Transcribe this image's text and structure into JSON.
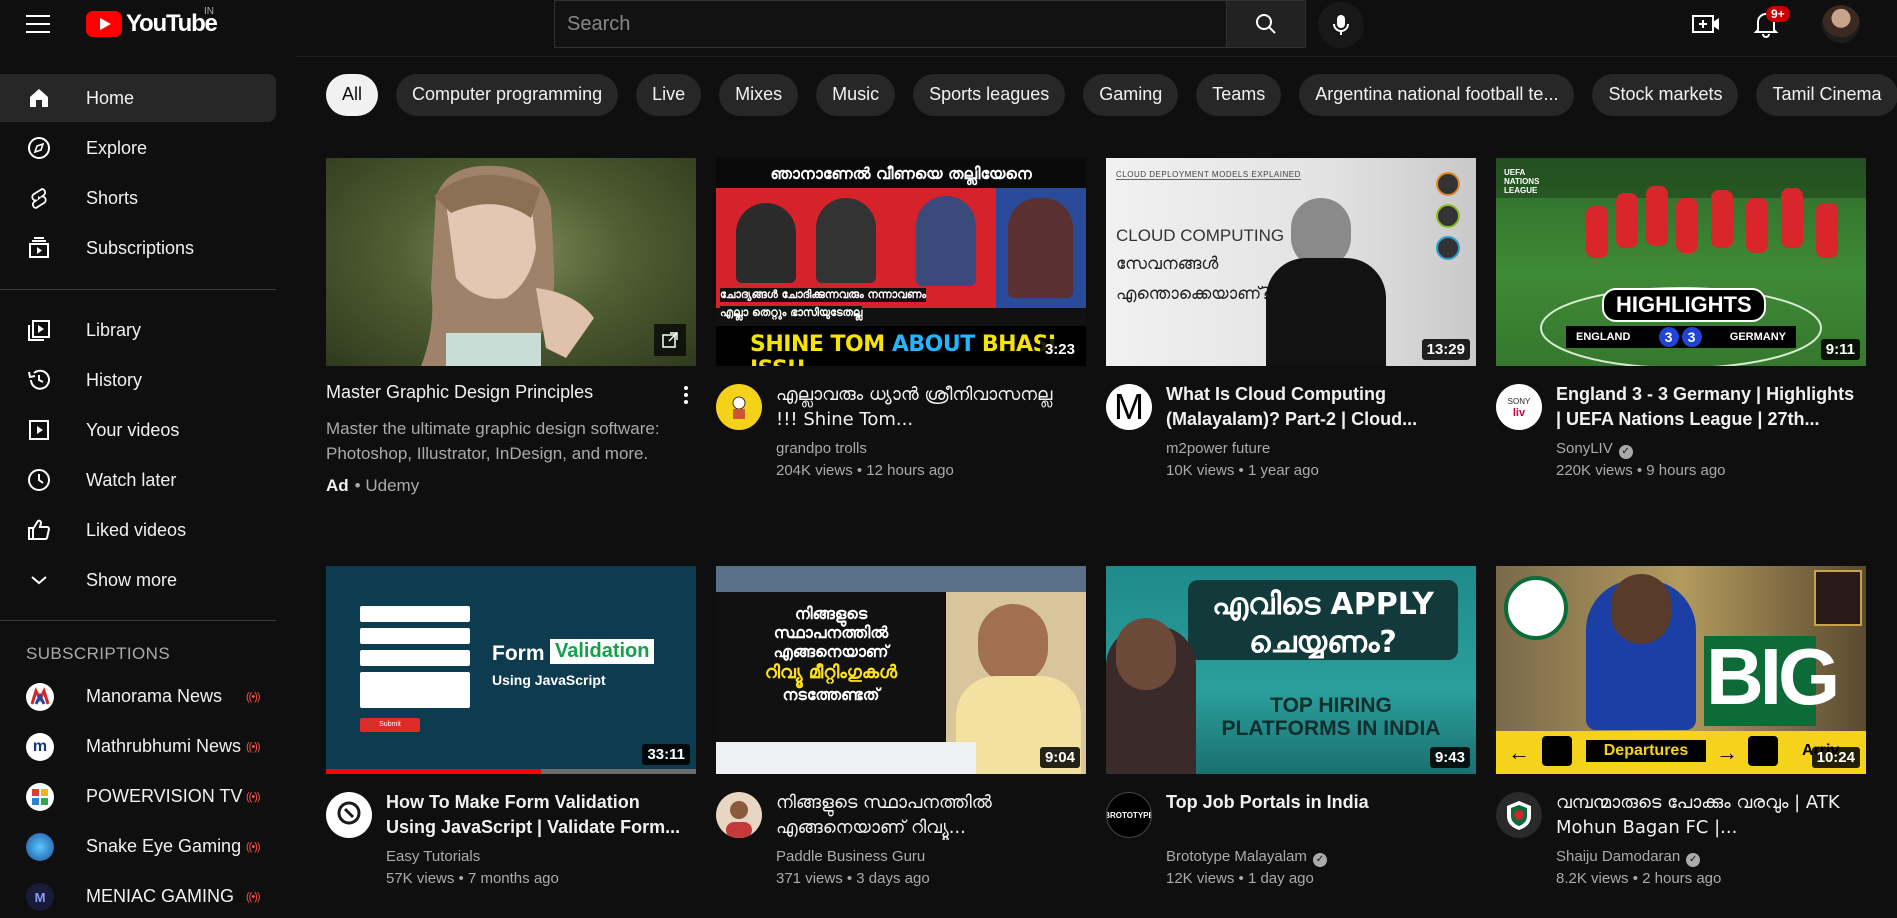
{
  "header": {
    "logo_text": "YouTube",
    "region": "IN",
    "search_placeholder": "Search",
    "notifications_badge": "9+"
  },
  "sidebar": {
    "main": [
      {
        "label": "Home",
        "icon": "home-icon",
        "active": true
      },
      {
        "label": "Explore",
        "icon": "compass-icon"
      },
      {
        "label": "Shorts",
        "icon": "shorts-icon"
      },
      {
        "label": "Subscriptions",
        "icon": "subscriptions-icon"
      }
    ],
    "library": [
      {
        "label": "Library",
        "icon": "library-icon"
      },
      {
        "label": "History",
        "icon": "history-icon"
      },
      {
        "label": "Your videos",
        "icon": "your-videos-icon"
      },
      {
        "label": "Watch later",
        "icon": "clock-icon"
      },
      {
        "label": "Liked videos",
        "icon": "thumbs-up-icon"
      },
      {
        "label": "Show more",
        "icon": "chevron-down-icon"
      }
    ],
    "subscriptions_heading": "SUBSCRIPTIONS",
    "subscriptions": [
      {
        "label": "Manorama News",
        "live": true,
        "color": "#ffffff"
      },
      {
        "label": "Mathrubhumi News",
        "live": true,
        "color": "#ffffff"
      },
      {
        "label": "POWERVISION TV",
        "live": true,
        "color": "#ffffff"
      },
      {
        "label": "Snake Eye Gaming",
        "live": true,
        "color": "#1f6fb8"
      },
      {
        "label": "MENIAC GAMING",
        "live": true,
        "color": "#1a1a3a"
      }
    ]
  },
  "chips": [
    "All",
    "Computer programming",
    "Live",
    "Mixes",
    "Music",
    "Sports leagues",
    "Gaming",
    "Teams",
    "Argentina national football te...",
    "Stock markets",
    "Tamil Cinema"
  ],
  "ad": {
    "title": "Master Graphic Design Principles",
    "description": "Master the ultimate graphic design software: Photoshop, Illustrator, InDesign, and more.",
    "ad_label": "Ad",
    "advertiser": "Udemy"
  },
  "videos": [
    {
      "title": "എല്ലാവരും ധ്യാൻ ശ്രീനിവാസനല്ല !!! Shine Tom...",
      "channel": "grandpo trolls",
      "verified": false,
      "meta": "204K views • 12 hours ago",
      "duration": "3:23"
    },
    {
      "title": "What Is Cloud Computing (Malayalam)? Part-2 | Cloud...",
      "channel": "m2power future",
      "verified": false,
      "meta": "10K views • 1 year ago",
      "duration": "13:29"
    },
    {
      "title": "England 3 - 3 Germany | Highlights | UEFA Nations League | 27th...",
      "channel": "SonyLIV",
      "verified": true,
      "meta": "220K views • 9 hours ago",
      "duration": "9:11"
    },
    {
      "title": "How To Make Form Validation Using JavaScript | Validate Form...",
      "channel": "Easy Tutorials",
      "verified": false,
      "meta": "57K views • 7 months ago",
      "duration": "33:11",
      "progress": 0.58
    },
    {
      "title": "നിങ്ങളുടെ സ്ഥാപനത്തിൽ എങ്ങനെയാണ് റിവ്യൂ...",
      "channel": "Paddle Business Guru",
      "verified": false,
      "meta": "371 views • 3 days ago",
      "duration": "9:04"
    },
    {
      "title": "Top Job Portals in India",
      "channel": "Brototype Malayalam",
      "verified": true,
      "meta": "12K views • 1 day ago",
      "duration": "9:43"
    },
    {
      "title": "വമ്പന്മാരുടെ പോക്കും വരവും | ATK Mohun Bagan FC |...",
      "channel": "Shaiju Damodaran",
      "verified": true,
      "meta": "8.2K views • 2 hours ago",
      "duration": "10:24"
    }
  ],
  "thumb_text": {
    "v1_top": "ഞാനാണേൽ വീണയെ തല്ലിയേനെ",
    "v1_mid": "ചോദ്യങ്ങൾ ചോദിക്കുന്നവരും നന്നാവണം",
    "v1_mid2": "എല്ലാ തെറ്റും ഭാസിയുടേതല്ല",
    "v1_bottom_a": "SHINE TOM",
    "v1_bottom_b": "ABOUT",
    "v1_bottom_c": "BHASI ISSU",
    "v2_small": "CLOUD DEPLOYMENT MODELS EXPLAINED",
    "v2_line1": "CLOUD COMPUTING",
    "v2_line2": "സേവനങ്ങൾ",
    "v2_line3": "എന്തൊക്കെയാണ്?",
    "v3_uefa": "UEFA NATIONS LEAGUE",
    "v3_highlights": "HIGHLIGHTS",
    "v3_team1": "ENGLAND",
    "v3_score1": "3",
    "v3_score2": "3",
    "v3_team2": "GERMANY",
    "v4_form": "Form",
    "v4_validation": "Validation",
    "v4_using": "Using JavaScript",
    "v4_submit": "Submit",
    "v5_l1": "നിങ്ങളുടെ",
    "v5_l2": "സ്ഥാപനത്തിൽ",
    "v5_l3": "എങ്ങനെയാണ്",
    "v5_l4": "റിവ്യൂ മീറ്റിംഗുകൾ",
    "v5_l5": "നടത്തേണ്ടത്",
    "v6_l1": "എവിടെ APPLY",
    "v6_l2": "ചെയ്യണം?",
    "v6_l3": "TOP HIRING",
    "v6_l4": "PLATFORMS IN INDIA",
    "v7_big": "BIG",
    "v7_departures": "Departures",
    "v7_arrivals": "Arriv"
  }
}
